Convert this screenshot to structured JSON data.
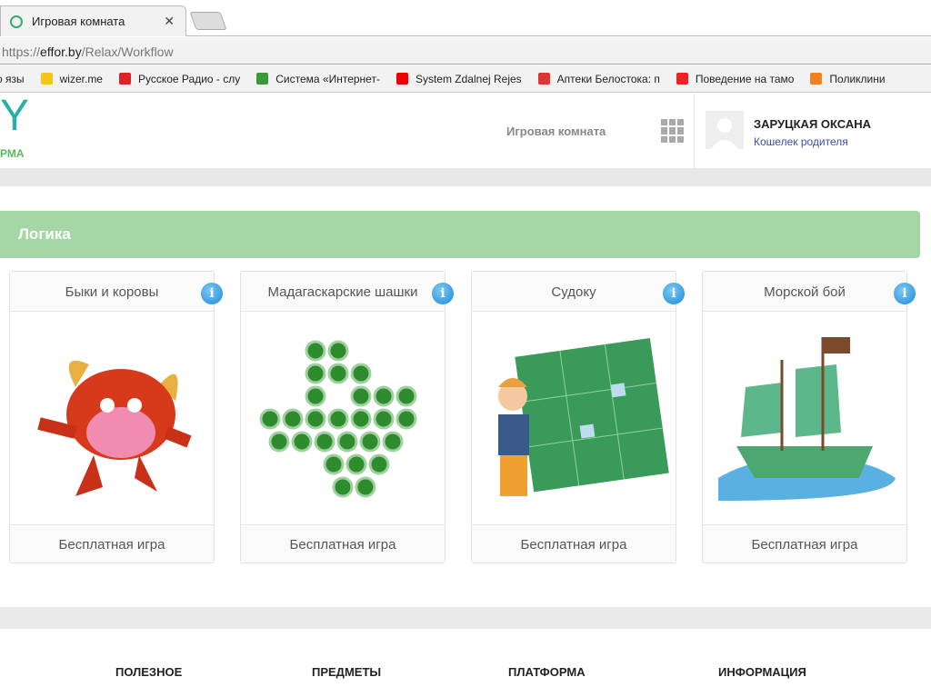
{
  "browser": {
    "tab_title": "Игровая комната",
    "url_scheme": "https://",
    "url_domain": "effor.by",
    "url_path": "/Relax/Workflow",
    "bookmarks": [
      {
        "label": "о язы",
        "color": "#fff"
      },
      {
        "label": "wizer.me",
        "color": "#f5c518"
      },
      {
        "label": "Русское Радио - слу",
        "color": "#d22"
      },
      {
        "label": "Система «Интернет-",
        "color": "#3a9a3a"
      },
      {
        "label": "System Zdalnej Rejes",
        "color": "#e00"
      },
      {
        "label": "Аптеки Белостока: п",
        "color": "#d33"
      },
      {
        "label": "Поведение на тамо",
        "color": "#e22"
      },
      {
        "label": "Поликлини",
        "color": "#f08020"
      }
    ]
  },
  "header": {
    "logo_letter": "Y",
    "logo_sub": "РМА",
    "nav_game_room": "Игровая комната",
    "user_name": "ЗАРУЦКАЯ ОКСАНА",
    "wallet_link": "Кошелек родителя"
  },
  "category": {
    "title": "Логика"
  },
  "games": [
    {
      "title": "Быки и коровы",
      "footer": "Бесплатная игра",
      "info": "i"
    },
    {
      "title": "Мадагаскарские шашки",
      "footer": "Бесплатная игра",
      "info": "i"
    },
    {
      "title": "Судоку",
      "footer": "Бесплатная игра",
      "info": "i"
    },
    {
      "title": "Морской бой",
      "footer": "Бесплатная игра",
      "info": "i"
    }
  ],
  "footer": {
    "headings": [
      "ПОЛЕЗНОЕ",
      "ПРЕДМЕТЫ",
      "ПЛАТФОРМА",
      "ИНФОРМАЦИЯ"
    ]
  }
}
